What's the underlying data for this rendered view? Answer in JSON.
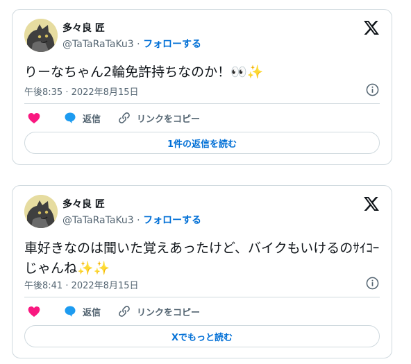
{
  "colors": {
    "accent": "#006fd6",
    "muted": "#536471",
    "border": "#cfd9de",
    "heart": "#f91880",
    "reply": "#1d9bf0"
  },
  "tweets": [
    {
      "author_name": "多々良 匠",
      "handle": "@TaTaRaTaKu3",
      "separator": "·",
      "follow_label": "フォローする",
      "text": "りーなちゃん2輪免許持ちなのか！👀✨",
      "timestamp": "午後8:35 · 2022年8月15日",
      "reply_label": "返信",
      "copy_label": "リンクをコピー",
      "footer_button": "1件の返信を読む"
    },
    {
      "author_name": "多々良 匠",
      "handle": "@TaTaRaTaKu3",
      "separator": "·",
      "follow_label": "フォローする",
      "text": "車好きなのは聞いた覚えあったけど、バイクもいけるのｻｲｺｰじゃんね✨✨",
      "timestamp": "午後8:41 · 2022年8月15日",
      "reply_label": "返信",
      "copy_label": "リンクをコピー",
      "footer_button": "Xでもっと読む"
    }
  ],
  "icons": {
    "x_logo": "x-logo-icon",
    "info": "info-icon",
    "like": "heart-icon",
    "reply": "speech-bubble-icon",
    "copy": "link-icon"
  }
}
